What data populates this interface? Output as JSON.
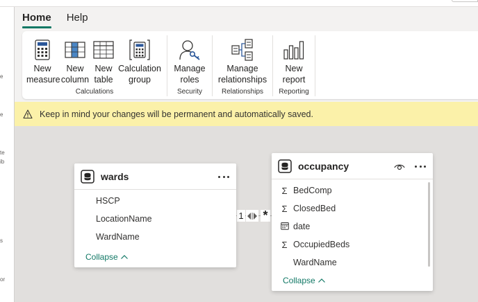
{
  "ribbon": {
    "tabs": [
      {
        "label": "Home",
        "active": true
      },
      {
        "label": "Help",
        "active": false
      }
    ],
    "groups": {
      "calculations": {
        "label": "Calculations",
        "buttons": [
          {
            "label": "New\nmeasure",
            "icon": "calculator-icon"
          },
          {
            "label": "New\ncolumn",
            "icon": "new-column-icon"
          },
          {
            "label": "New\ntable",
            "icon": "new-table-icon"
          },
          {
            "label": "Calculation\ngroup",
            "icon": "calculation-group-icon"
          }
        ]
      },
      "security": {
        "label": "Security",
        "buttons": [
          {
            "label": "Manage\nroles",
            "icon": "manage-roles-icon"
          }
        ]
      },
      "relationships": {
        "label": "Relationships",
        "buttons": [
          {
            "label": "Manage\nrelationships",
            "icon": "manage-relationships-icon"
          }
        ]
      },
      "reporting": {
        "label": "Reporting",
        "buttons": [
          {
            "label": "New\nreport",
            "icon": "bar-chart-icon"
          }
        ]
      }
    }
  },
  "warning": {
    "icon": "warning-icon",
    "text": "Keep in mind your changes will be permanent and automatically saved."
  },
  "tables": {
    "wards": {
      "name": "wards",
      "fields": [
        {
          "name": "HSCP",
          "icon": ""
        },
        {
          "name": "LocationName",
          "icon": ""
        },
        {
          "name": "WardName",
          "icon": ""
        }
      ],
      "collapse_label": "Collapse"
    },
    "occupancy": {
      "name": "occupancy",
      "fields": [
        {
          "name": "BedComp",
          "icon": "sigma-icon"
        },
        {
          "name": "ClosedBed",
          "icon": "sigma-icon"
        },
        {
          "name": "date",
          "icon": "calendar-icon"
        },
        {
          "name": "OccupiedBeds",
          "icon": "sigma-icon"
        },
        {
          "name": "WardName",
          "icon": ""
        }
      ],
      "collapse_label": "Collapse"
    }
  },
  "relationship": {
    "from_cardinality": "1",
    "to_cardinality": "*",
    "filter_direction": "both"
  },
  "colors": {
    "accent": "#117865",
    "warning_bg": "#fbf1a9",
    "canvas_bg": "#e1dfdd",
    "ribbon_bg": "#f3f2f1"
  },
  "left_pane_fragments": [
    "e",
    "e",
    "te",
    "ib",
    "s",
    "or"
  ]
}
